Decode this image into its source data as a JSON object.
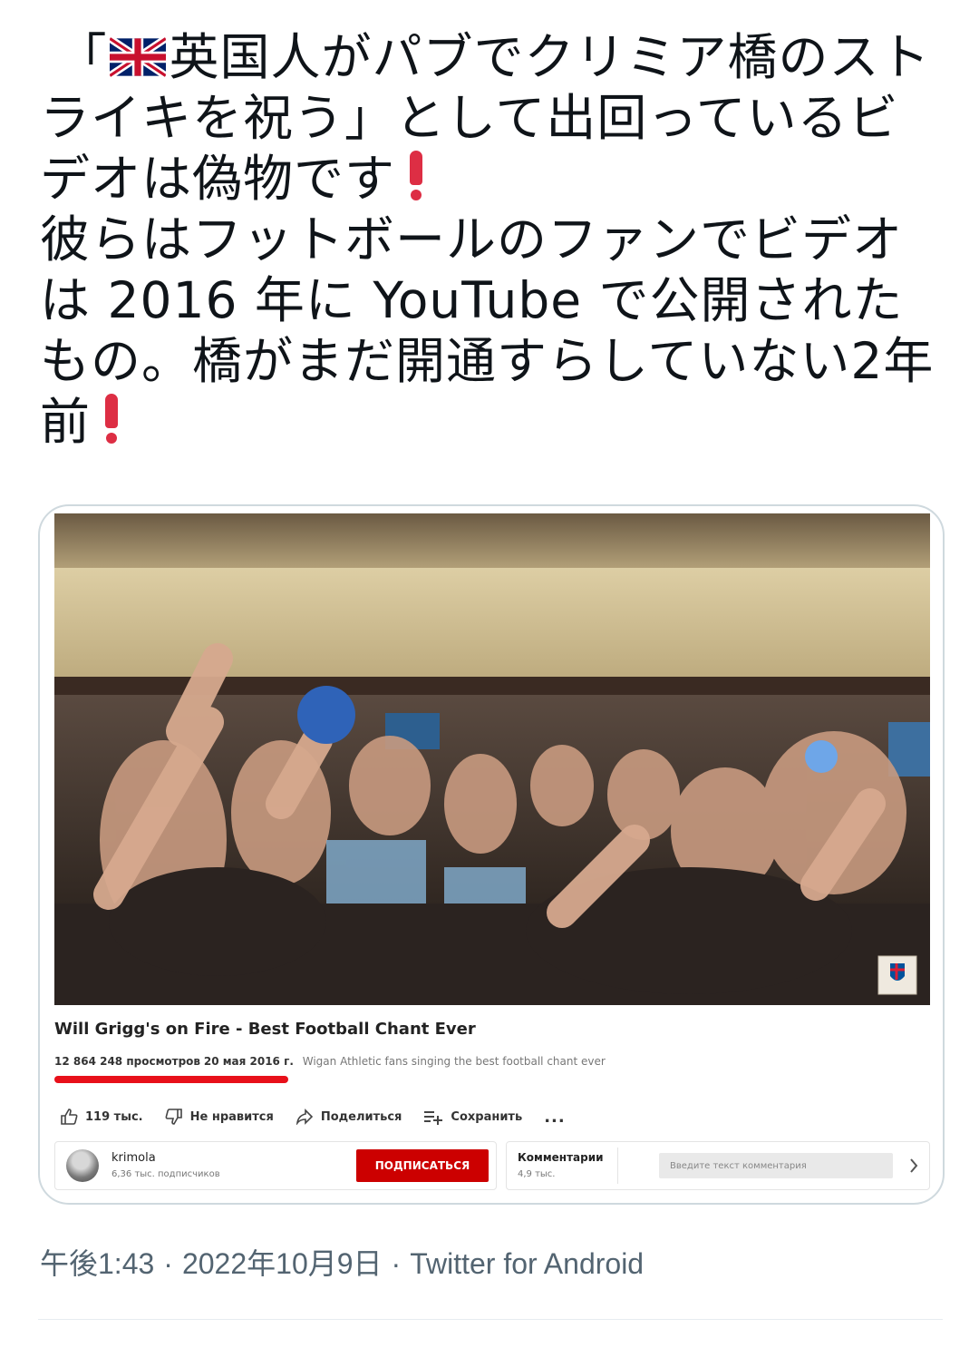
{
  "tweet": {
    "lines": [
      "「",
      "英国人がパブでクリミア橋のストライキを祝う」として出回っているビデオは偽物です",
      "彼らはフットボールのファンでビデオは 2016 年に YouTube で公開されたもの。橋がまだ開通すらしていない2年前"
    ],
    "flag_icon": "uk-flag-icon",
    "exclamation_icon": "red-exclamation-icon"
  },
  "media": {
    "logo_icon": "iceland-crest-icon",
    "youtube": {
      "title": "Will Grigg's on Fire - Best Football Chant Ever",
      "views": "12 864 248 просмотров",
      "date": "20 мая 2016 г.",
      "description": "Wigan Athletic fans singing the best football chant ever",
      "likes": "119 тыс.",
      "dislike_label": "Не нравится",
      "share_label": "Поделиться",
      "save_label": "Сохранить",
      "more_label": "...",
      "channel_name": "krimola",
      "channel_subs": "6,36 тыс. подписчиков",
      "subscribe_label": "ПОДПИСАТЬСЯ",
      "comments_label": "Комментарии",
      "comments_count": "4,9 тыс.",
      "comment_placeholder": "Введите текст комментария",
      "accent_color": "#cc0000",
      "underline_color": "#e8101a"
    }
  },
  "footer": {
    "time": "午後1:43",
    "date": "2022年10月9日",
    "separator": "·",
    "client": "Twitter for Android"
  }
}
